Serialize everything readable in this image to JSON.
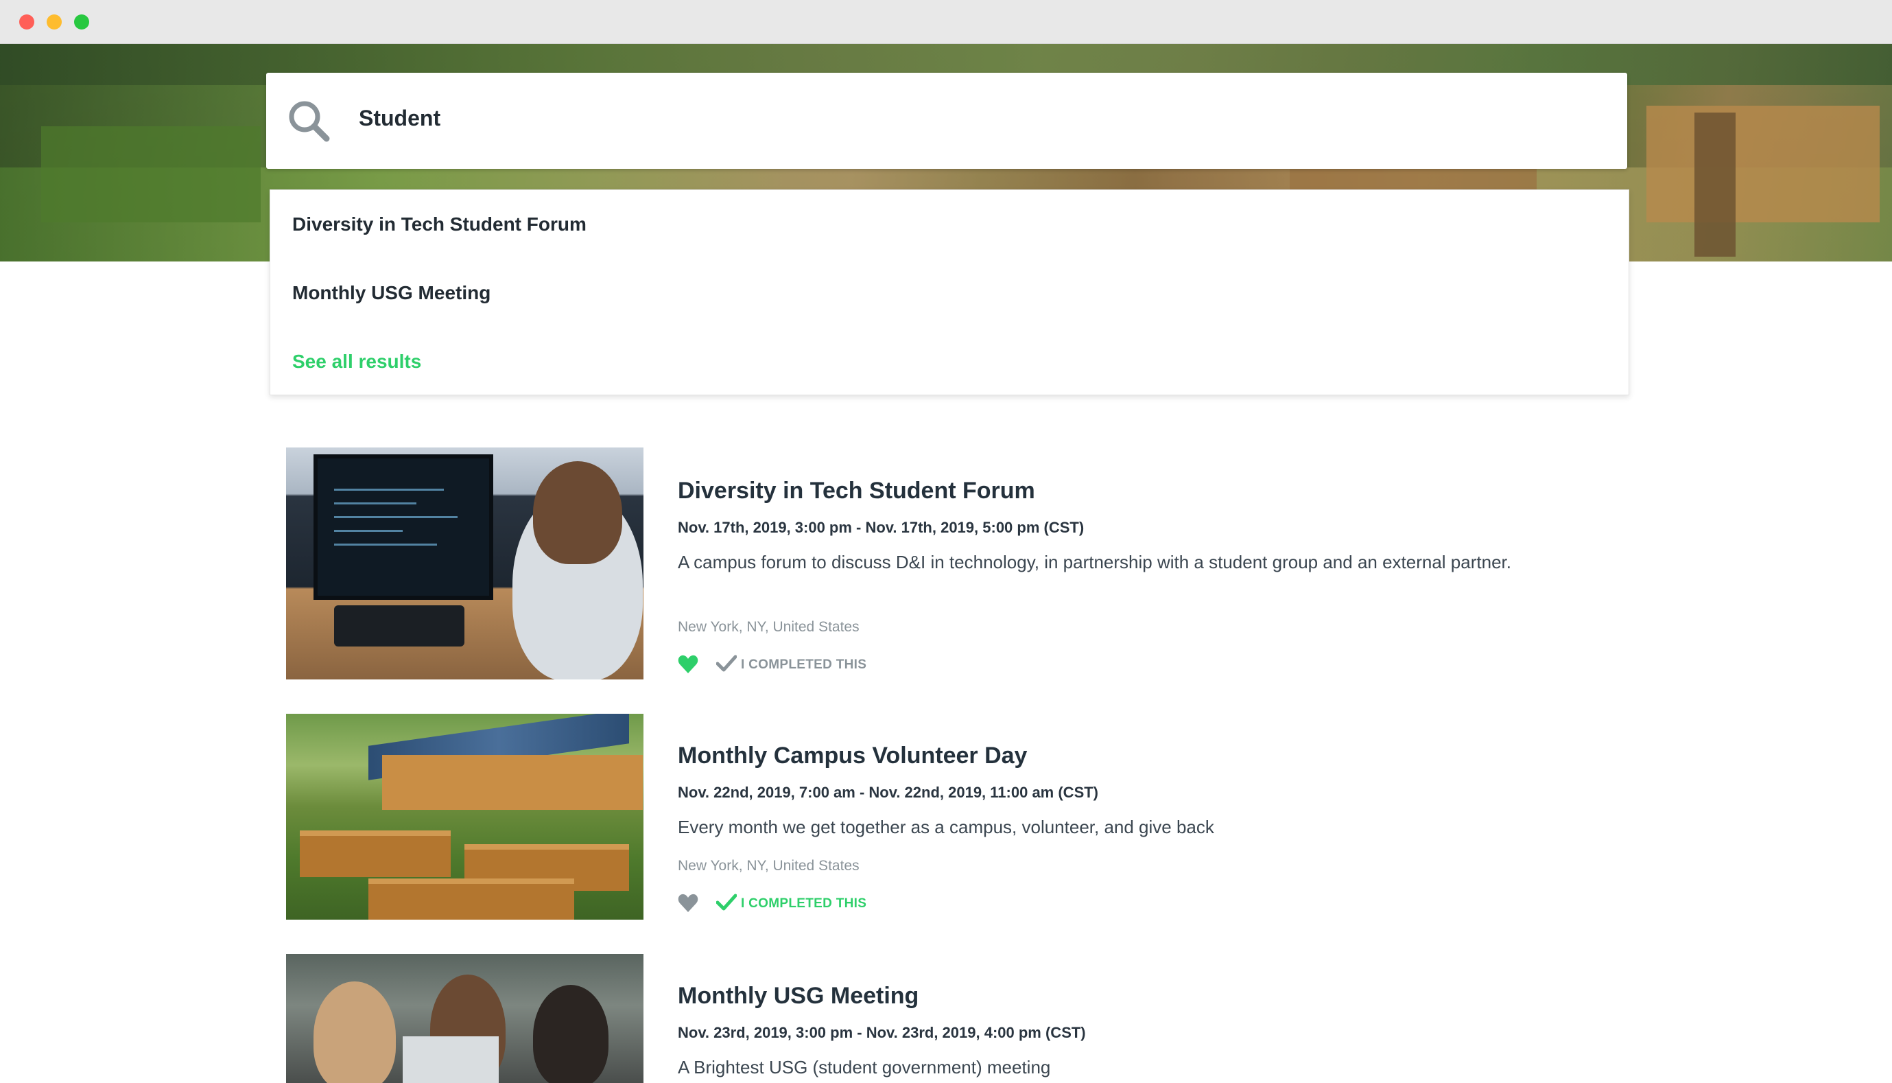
{
  "search": {
    "value": "Student"
  },
  "suggestions": {
    "items": [
      {
        "label": "Diversity in Tech Student Forum"
      },
      {
        "label": "Monthly USG Meeting"
      }
    ],
    "see_all": "See all results"
  },
  "events": [
    {
      "title": "Diversity in Tech Student Forum",
      "date": "Nov. 17th, 2019, 3:00 pm - Nov. 17th, 2019, 5:00 pm (CST)",
      "description": "A campus forum to discuss D&I in technology, in partnership with a student group and an external partner.",
      "location": "New York, NY, United States",
      "favorited": true,
      "completed": false,
      "completed_label": "I COMPLETED THIS"
    },
    {
      "title": "Monthly Campus Volunteer Day",
      "date": "Nov. 22nd, 2019, 7:00 am - Nov. 22nd, 2019, 11:00 am (CST)",
      "description": "Every month we get together as a campus, volunteer, and give back",
      "location": "New York, NY, United States",
      "favorited": false,
      "completed": true,
      "completed_label": "I COMPLETED THIS"
    },
    {
      "title": "Monthly USG Meeting",
      "date": "Nov. 23rd, 2019, 3:00 pm - Nov. 23rd, 2019, 4:00 pm (CST)",
      "description": "A Brightest USG (student government) meeting"
    }
  ],
  "colors": {
    "accent_green": "#2ecf6a",
    "muted_gray": "#8a9399",
    "text_dark": "#24313c"
  },
  "icons": {
    "search": "search-icon",
    "favorite": "heart-icon",
    "completed": "check-icon"
  }
}
